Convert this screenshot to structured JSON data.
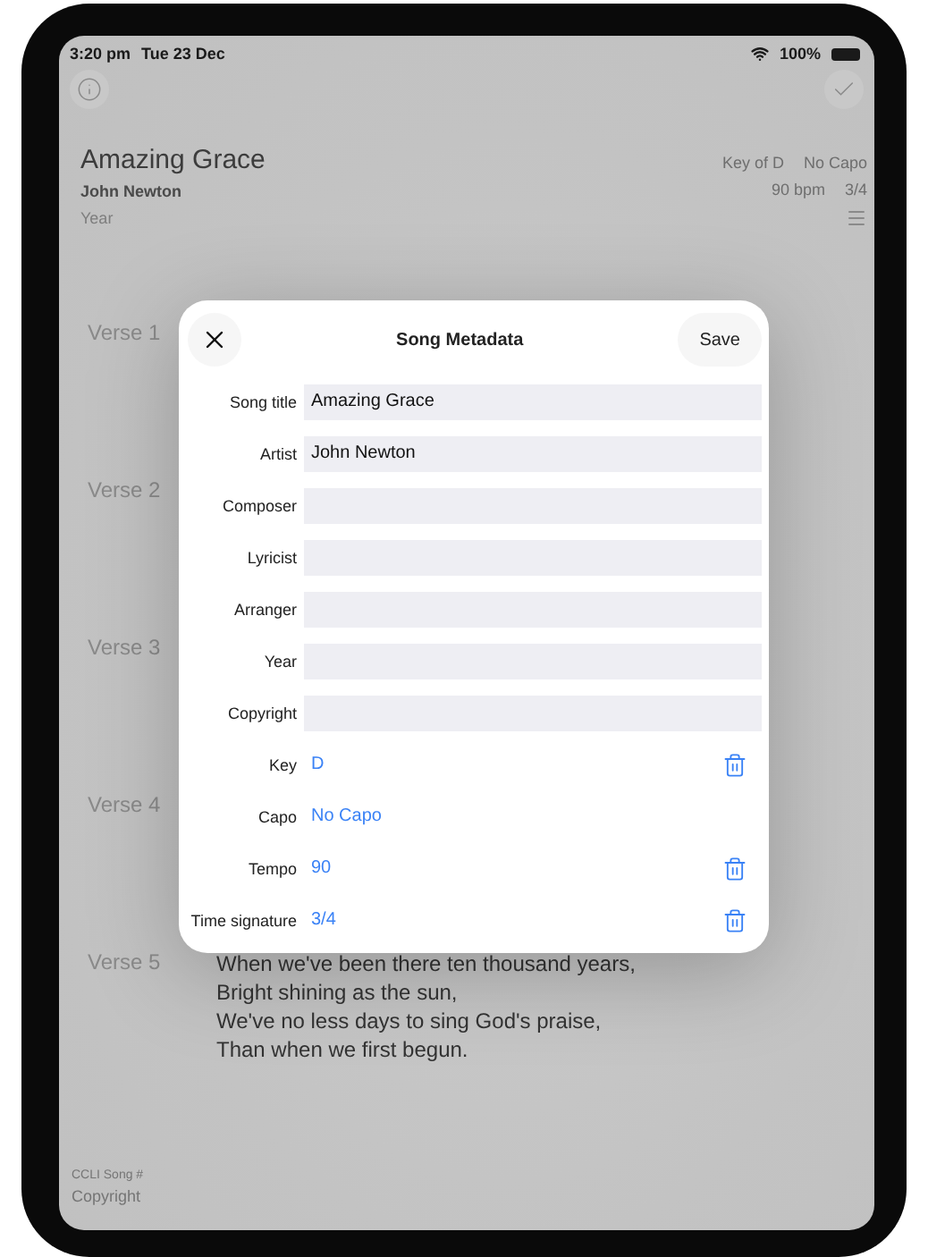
{
  "status_bar": {
    "time": "3:20 pm",
    "date": "Tue 23 Dec",
    "battery": "100%"
  },
  "song": {
    "title": "Amazing Grace",
    "artist": "John Newton",
    "year_placeholder": "Year",
    "meta": [
      [
        "Key of D",
        "No Capo"
      ],
      [
        "90 bpm",
        "3/4"
      ]
    ]
  },
  "verses": [
    {
      "label": "Verse 1"
    },
    {
      "label": "Verse 2"
    },
    {
      "label": "Verse 3"
    },
    {
      "label": "Verse 4"
    },
    {
      "label": "Verse 5",
      "lines": [
        "When we've been there ten thousand years,",
        "Bright shining as the sun,",
        "We've no less days to sing God's praise,",
        "Than when we first begun."
      ]
    }
  ],
  "footer": {
    "ccli": "CCLI Song #",
    "copyright": "Copyright"
  },
  "modal": {
    "title": "Song Metadata",
    "save": "Save",
    "fields": [
      {
        "label": "Song title",
        "kind": "text",
        "value": "Amazing Grace"
      },
      {
        "label": "Artist",
        "kind": "text",
        "value": "John Newton"
      },
      {
        "label": "Composer",
        "kind": "text"
      },
      {
        "label": "Lyricist",
        "kind": "text"
      },
      {
        "label": "Arranger",
        "kind": "text"
      },
      {
        "label": "Year",
        "kind": "text"
      },
      {
        "label": "Copyright",
        "kind": "text"
      },
      {
        "label": "Key",
        "kind": "choice",
        "value": "D",
        "clearable": true
      },
      {
        "label": "Capo",
        "kind": "choice",
        "value": "No Capo",
        "clearable": false
      },
      {
        "label": "Tempo",
        "kind": "choice",
        "value": "90",
        "clearable": true
      },
      {
        "label": "Time signature",
        "kind": "choice",
        "value": "3/4",
        "clearable": true
      }
    ]
  }
}
